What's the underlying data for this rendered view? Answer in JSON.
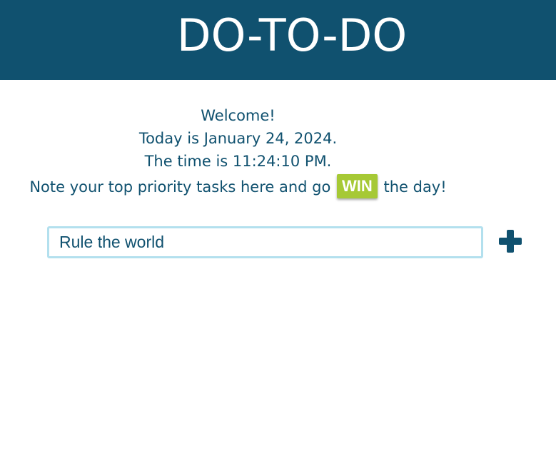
{
  "header": {
    "title": "DO-TO-DO"
  },
  "welcome": {
    "greeting": "Welcome!",
    "date_line": "Today is January 24, 2024.",
    "time_line": "The time is 11:24:10 PM.",
    "priority_prefix": "Note your top priority tasks here and go",
    "win_badge": "WIN",
    "priority_suffix": "the day!"
  },
  "task_entry": {
    "value": "Rule the world",
    "placeholder": ""
  },
  "add_button": {
    "icon": "plus-icon"
  },
  "colors": {
    "primary": "#10516f",
    "accent": "#a6c935",
    "input_border": "#b3e0ee"
  }
}
